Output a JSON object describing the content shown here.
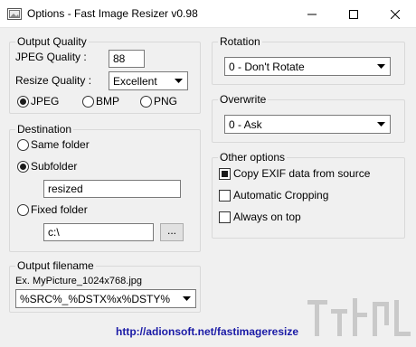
{
  "window": {
    "title": "Options - Fast Image Resizer v0.98",
    "controls": [
      "minimize-icon",
      "maximize-icon",
      "close-icon"
    ]
  },
  "output_quality": {
    "legend": "Output Quality",
    "jpeg_quality_label": "JPEG Quality :",
    "jpeg_quality_value": "88",
    "resize_quality_label": "Resize Quality :",
    "resize_quality_value": "Excellent",
    "formats": [
      {
        "label": "JPEG",
        "selected": true
      },
      {
        "label": "BMP",
        "selected": false
      },
      {
        "label": "PNG",
        "selected": false
      }
    ]
  },
  "destination": {
    "legend": "Destination",
    "options": [
      {
        "label": "Same folder",
        "selected": false
      },
      {
        "label": "Subfolder",
        "selected": true
      },
      {
        "label": "Fixed folder",
        "selected": false
      }
    ],
    "subfolder_value": "resized",
    "fixed_folder_value": "c:\\",
    "browse_label": "..."
  },
  "output_filename": {
    "legend": "Output filename",
    "example": "Ex. MyPicture_1024x768.jpg",
    "pattern": "%SRC%_%DSTX%x%DSTY%"
  },
  "rotation": {
    "legend": "Rotation",
    "value": "0 - Don't Rotate"
  },
  "overwrite": {
    "legend": "Overwrite",
    "value": "0 - Ask"
  },
  "other_options": {
    "legend": "Other options",
    "items": [
      {
        "label": "Copy EXIF data from source",
        "checked": true
      },
      {
        "label": "Automatic Cropping",
        "checked": false
      },
      {
        "label": "Always on top",
        "checked": false
      }
    ]
  },
  "footer": {
    "link": "http://adionsoft.net/fastimageresize"
  },
  "colors": {
    "link": "#1a1aa6",
    "window_bg": "#f0f0f0",
    "group_border": "#d9d9d9"
  }
}
